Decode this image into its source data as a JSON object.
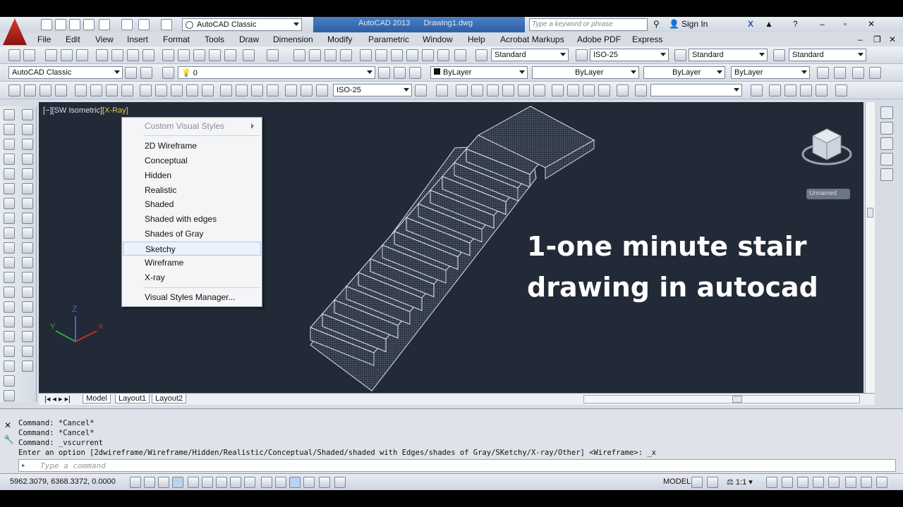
{
  "app": {
    "workspace": "AutoCAD Classic",
    "product": "AutoCAD 2013",
    "filename": "Drawing1.dwg",
    "search_placeholder": "Type a keyword or phrase",
    "sign_in": "Sign In"
  },
  "menubar": [
    "File",
    "Edit",
    "View",
    "Insert",
    "Format",
    "Tools",
    "Draw",
    "Dimension",
    "Modify",
    "Parametric",
    "Window",
    "Help",
    "Acrobat Markups",
    "Adobe PDF",
    "Express"
  ],
  "toolbar1": {
    "text_style": "Standard",
    "dim_style": "ISO-25",
    "table_style": "Standard",
    "mleader_style": "Standard"
  },
  "toolbar2": {
    "workspace": "AutoCAD Classic",
    "layer": "0",
    "color": "ByLayer",
    "linetype": "ByLayer",
    "lineweight": "ByLayer",
    "plotstyle": "ByLayer"
  },
  "toolbar3": {
    "dim_style": "ISO-25"
  },
  "viewport": {
    "label_prefix": "[−][SW Isometric]",
    "label_style": "[X-Ray]",
    "viewcube_label": "Unnamed",
    "overlay_line1": "1-one minute stair",
    "overlay_line2": "drawing in autocad"
  },
  "context_menu": {
    "header": "Custom Visual Styles",
    "items": [
      "2D Wireframe",
      "Conceptual",
      "Hidden",
      "Realistic",
      "Shaded",
      "Shaded with edges",
      "Shades of Gray",
      "Sketchy",
      "Wireframe",
      "X-ray"
    ],
    "selected": "Sketchy",
    "footer": "Visual Styles Manager..."
  },
  "tabs": [
    "Model",
    "Layout1",
    "Layout2"
  ],
  "command": {
    "history": [
      "Command: *Cancel*",
      "Command: *Cancel*",
      "Command: _vscurrent",
      "Enter an option [2dwireframe/Wireframe/Hidden/Realistic/Conceptual/Shaded/shaded with Edges/shades of Gray/SKetchy/X-ray/Other] <Wireframe>: _x"
    ],
    "placeholder": "Type a command"
  },
  "status": {
    "coords": "5962.3079, 6368.3372, 0.0000",
    "model": "MODEL",
    "scale": "1:1"
  },
  "colors": {
    "viewport_bg": "#222a37",
    "title_accent": "#2e5ea5",
    "xray_label": "#e8c93b"
  }
}
